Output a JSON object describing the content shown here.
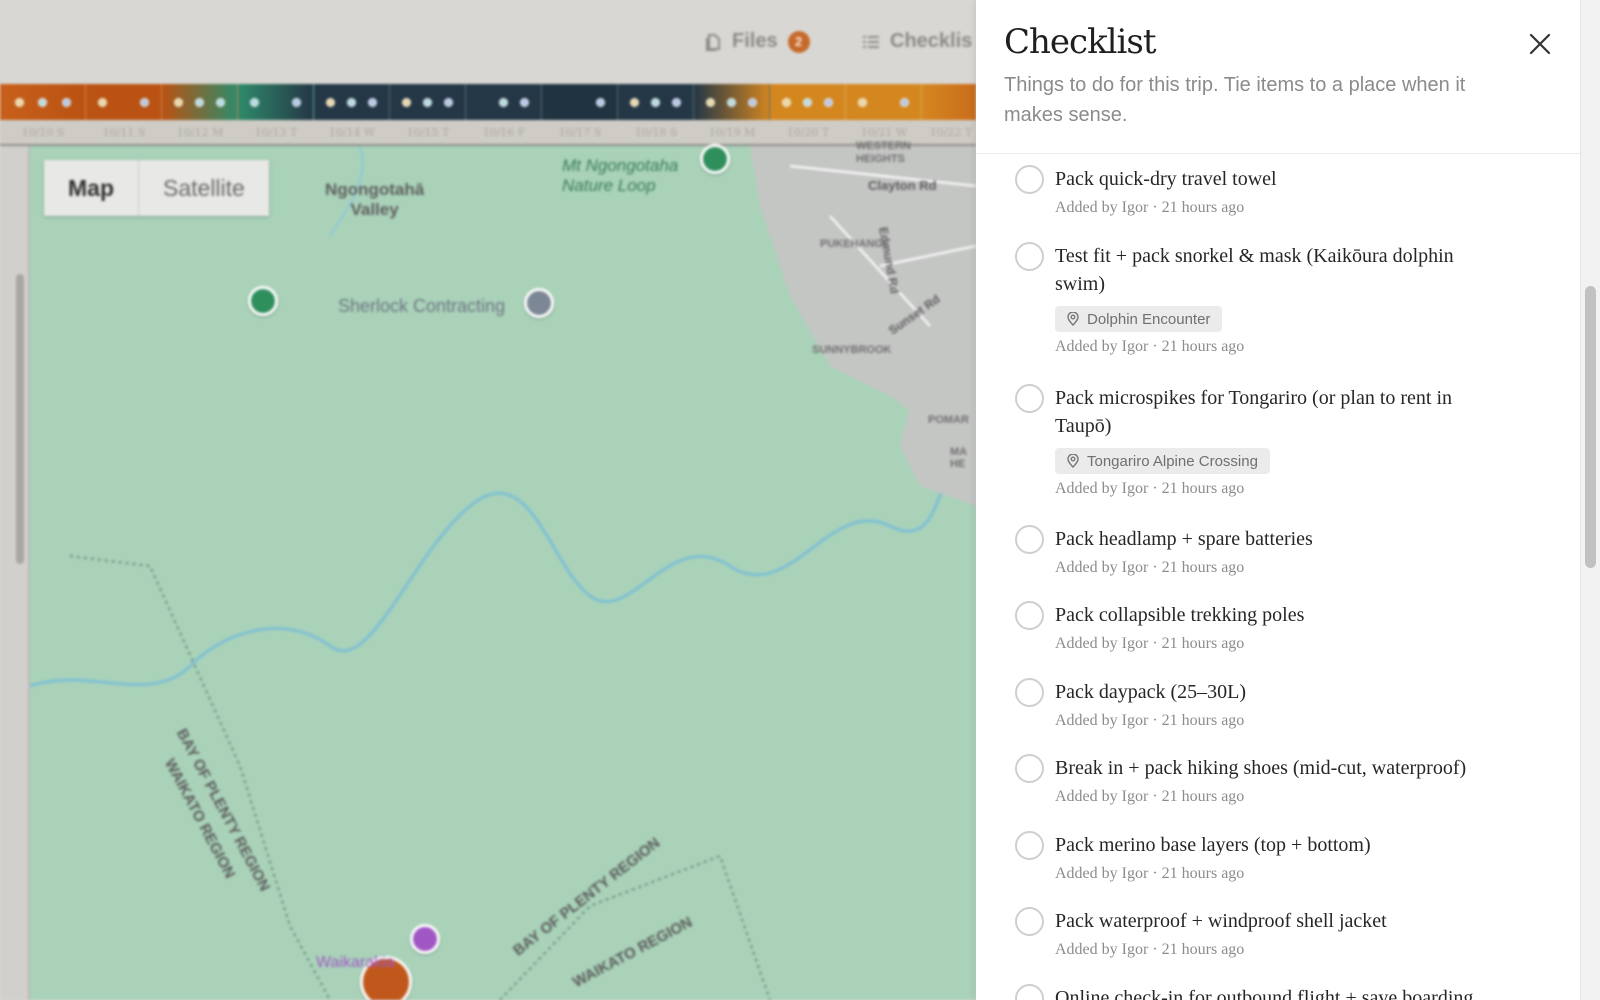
{
  "topbar": {
    "files_label": "Files",
    "files_count": "2",
    "checklist_label": "Checklis"
  },
  "timeline": {
    "dates": [
      "10/10 S",
      "10/11 S",
      "10/12 M",
      "10/13 T",
      "10/14 W",
      "10/15 T",
      "10/16 F",
      "10/17 S",
      "10/18 S",
      "10/19 M",
      "10/20 T",
      "10/21 W",
      "10/22 T"
    ]
  },
  "map": {
    "toggle_map": "Map",
    "toggle_satellite": "Satellite",
    "labels": {
      "valley": "Ngongotahā\nValley",
      "nature_loop": "Mt Ngongotaha\nNature Loop",
      "sherlock": "Sherlock Contracting",
      "western_heights": "WESTERN\nHEIGHTS",
      "clayton": "Clayton Rd",
      "pukehangi": "PUKEHANGI",
      "edmund": "Edmund Rd",
      "sunset": "Sunset Rd",
      "sunnybrook": "SUNNYBROOK",
      "pomare": "POMAR",
      "mahe": "MA\nHE",
      "region_a": "BAY OF PLENTY REGION",
      "region_b": "WAIKATO REGION",
      "region_c": "BAY OF PLENTY REGION",
      "region_d": "WAIKATO REGION",
      "waikarakia": "Waikarakia"
    },
    "colors": {
      "water": "#7fc0d3",
      "land": "#a9d2b9",
      "poi": "#a057c4"
    }
  },
  "checklist": {
    "title": "Checklist",
    "subtitle": "Things to do for this trip. Tie items to a place when it makes sense.",
    "items": [
      {
        "title": "Pack quick-dry travel towel",
        "meta": "Added by Igor · 21 hours ago",
        "place": ""
      },
      {
        "title": "Test fit + pack snorkel & mask (Kaikōura dolphin swim)",
        "meta": "Added by Igor · 21 hours ago",
        "place": "Dolphin Encounter"
      },
      {
        "title": "Pack microspikes for Tongariro (or plan to rent in Taupō)",
        "meta": "Added by Igor · 21 hours ago",
        "place": "Tongariro Alpine Crossing"
      },
      {
        "title": "Pack headlamp + spare batteries",
        "meta": "Added by Igor · 21 hours ago",
        "place": ""
      },
      {
        "title": "Pack collapsible trekking poles",
        "meta": "Added by Igor · 21 hours ago",
        "place": ""
      },
      {
        "title": "Pack daypack (25–30L)",
        "meta": "Added by Igor · 21 hours ago",
        "place": ""
      },
      {
        "title": "Break in + pack hiking shoes (mid-cut, waterproof)",
        "meta": "Added by Igor · 21 hours ago",
        "place": ""
      },
      {
        "title": "Pack merino base layers (top + bottom)",
        "meta": "Added by Igor · 21 hours ago",
        "place": ""
      },
      {
        "title": "Pack waterproof + windproof shell jacket",
        "meta": "Added by Igor · 21 hours ago",
        "place": ""
      },
      {
        "title": "Online check-in for outbound flight + save boarding",
        "meta": "",
        "place": ""
      }
    ]
  },
  "icons": {
    "close": "close-icon",
    "files": "files-icon",
    "checklist": "list-icon",
    "place": "map-pin-icon"
  }
}
